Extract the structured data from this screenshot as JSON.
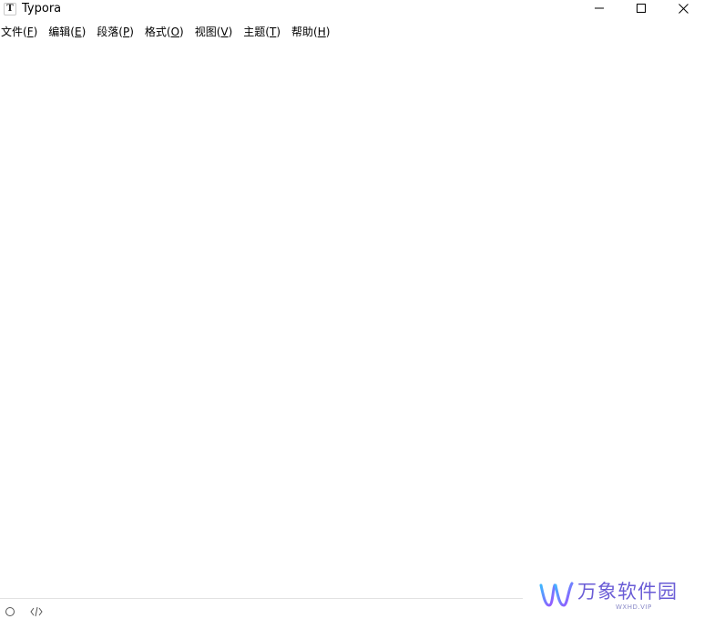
{
  "titlebar": {
    "icon_letter": "T",
    "title": "Typora"
  },
  "menubar": {
    "items": [
      {
        "label": "文件(",
        "mnemonic": "F",
        "close": ")"
      },
      {
        "label": "编辑(",
        "mnemonic": "E",
        "close": ")"
      },
      {
        "label": "段落(",
        "mnemonic": "P",
        "close": ")"
      },
      {
        "label": "格式(",
        "mnemonic": "O",
        "close": ")"
      },
      {
        "label": "视图(",
        "mnemonic": "V",
        "close": ")"
      },
      {
        "label": "主题(",
        "mnemonic": "T",
        "close": ")"
      },
      {
        "label": "帮助(",
        "mnemonic": "H",
        "close": ")"
      }
    ]
  },
  "statusbar": {
    "left_icons": [
      "circle-outline-icon",
      "code-icon"
    ]
  },
  "watermark": {
    "brand": "万象软件园",
    "site": "WXHD.VIP",
    "colors": {
      "primary": "#6a5cd6",
      "accent": "#3fb6ff"
    }
  }
}
